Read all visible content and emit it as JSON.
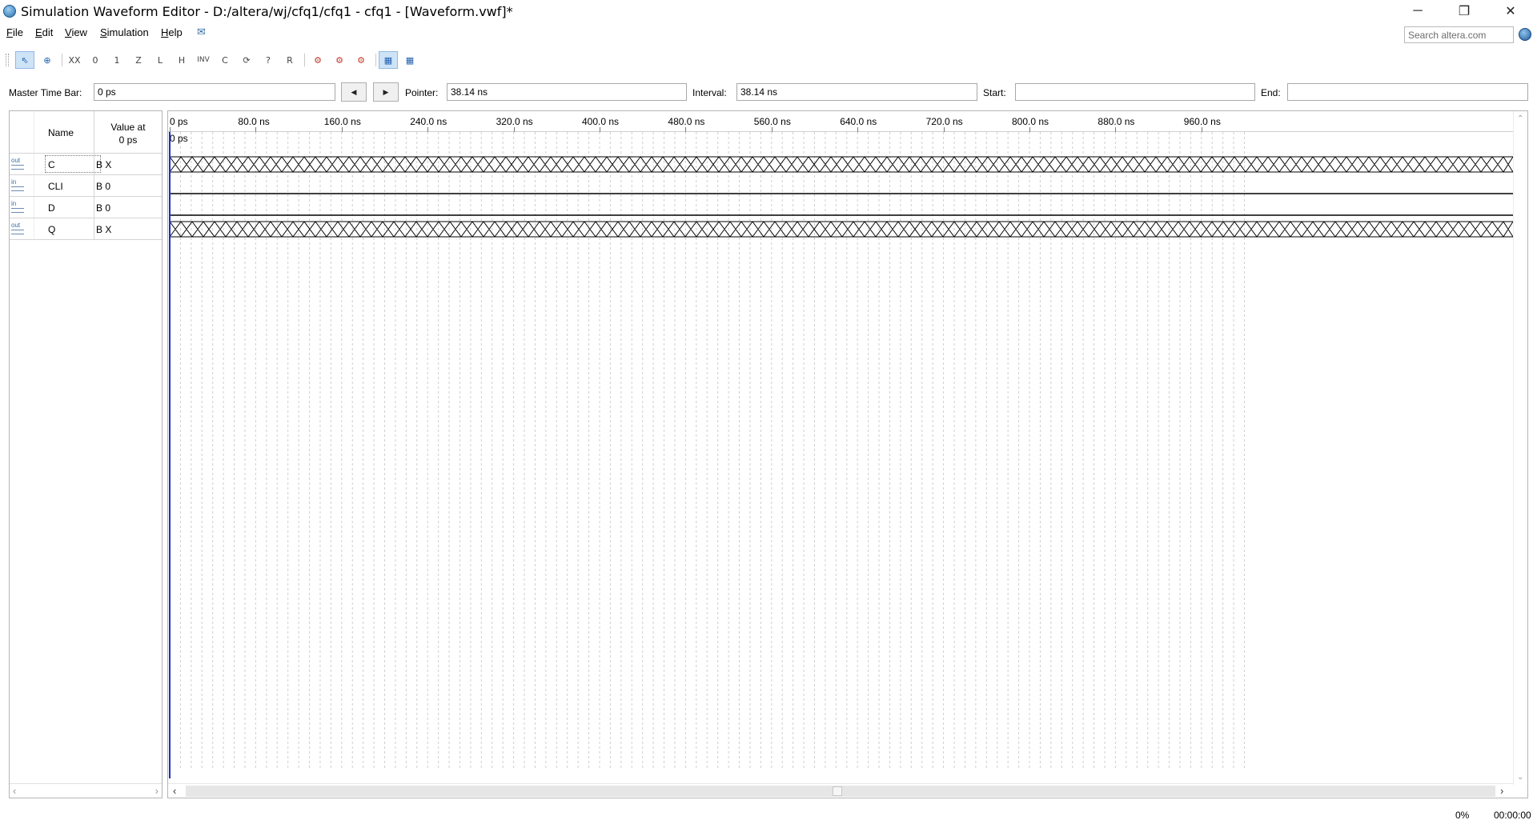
{
  "window": {
    "title": "Simulation Waveform Editor - D:/altera/wj/cfq1/cfq1 - cfq1 - [Waveform.vwf]*",
    "minimize_glyph": "─",
    "restore_glyph": "❐",
    "close_glyph": "✕"
  },
  "menu": {
    "items": [
      {
        "label": "File",
        "hotkey": "F",
        "rest": "ile"
      },
      {
        "label": "Edit",
        "hotkey": "E",
        "rest": "dit"
      },
      {
        "label": "View",
        "hotkey": "V",
        "rest": "iew"
      },
      {
        "label": "Simulation",
        "hotkey": "S",
        "rest": "imulation"
      },
      {
        "label": "Help",
        "hotkey": "H",
        "rest": "elp"
      }
    ],
    "search_placeholder": "Search altera.com"
  },
  "toolbar": {
    "buttons": [
      {
        "name": "selection-tool",
        "glyph": "⇖",
        "active": true
      },
      {
        "name": "zoom-tool",
        "glyph": "⊕"
      },
      {
        "name": "forcing-unknown",
        "glyph": "XX"
      },
      {
        "name": "forcing-low",
        "glyph": "0"
      },
      {
        "name": "forcing-high",
        "glyph": "1"
      },
      {
        "name": "high-impedance",
        "glyph": "Z"
      },
      {
        "name": "weak-low",
        "glyph": "L"
      },
      {
        "name": "weak-high",
        "glyph": "H"
      },
      {
        "name": "invert",
        "glyph": "INV"
      },
      {
        "name": "count-value",
        "glyph": "C"
      },
      {
        "name": "clock",
        "glyph": "⟳"
      },
      {
        "name": "arbitrary-value",
        "glyph": "?"
      },
      {
        "name": "random-value",
        "glyph": "R"
      },
      {
        "name": "functional-simulation",
        "glyph": "⚙"
      },
      {
        "name": "timing-simulation",
        "glyph": "⚙"
      },
      {
        "name": "netlist-viewer",
        "glyph": "⚙"
      },
      {
        "name": "snap-to-grid",
        "glyph": "▦",
        "active": true
      },
      {
        "name": "grid-options",
        "glyph": "▦"
      }
    ]
  },
  "timebar": {
    "master_label": "Master Time Bar:",
    "master_value": "0 ps",
    "pointer_label": "Pointer:",
    "pointer_value": "38.14 ns",
    "interval_label": "Interval:",
    "interval_value": "38.14 ns",
    "start_label": "Start:",
    "start_value": "",
    "end_label": "End:",
    "end_value": ""
  },
  "signal_table": {
    "name_header": "Name",
    "value_header_line1": "Value at",
    "value_header_line2": "0 ps",
    "signals": [
      {
        "type": "out",
        "name": "C",
        "value": "B X",
        "waveform": "X"
      },
      {
        "type": "in",
        "name": "CLI",
        "value": "B 0",
        "waveform": "0"
      },
      {
        "type": "in",
        "name": "D",
        "value": "B 0",
        "waveform": "0"
      },
      {
        "type": "out",
        "name": "Q",
        "value": "B X",
        "waveform": "X"
      }
    ]
  },
  "timeline": {
    "ticks": [
      "0 ps",
      "80.0 ns",
      "160.0 ns",
      "240.0 ns",
      "320.0 ns",
      "400.0 ns",
      "480.0 ns",
      "560.0 ns",
      "640.0 ns",
      "720.0 ns",
      "800.0 ns",
      "880.0 ns",
      "960.0 ns"
    ],
    "cursor_label": "0 ps",
    "range_ns": [
      0,
      1000
    ],
    "grid_step_ns": 10
  },
  "status": {
    "progress": "0%",
    "elapsed": "00:00:00"
  },
  "colors": {
    "cursor": "#1d2fc0",
    "wave": "#000000",
    "grid": "#cfcfcf",
    "active_button": "#cfe3f7"
  }
}
